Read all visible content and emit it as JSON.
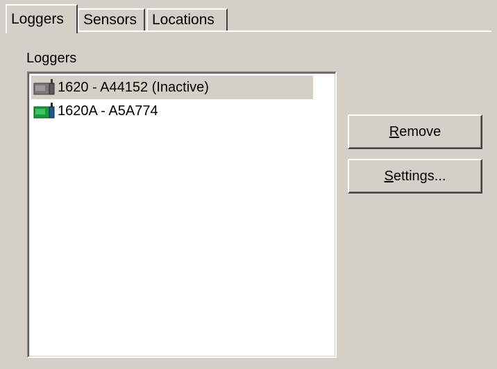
{
  "tabs": [
    {
      "label": "Loggers",
      "active": true
    },
    {
      "label": "Sensors",
      "active": false
    },
    {
      "label": "Locations",
      "active": false
    }
  ],
  "loggers_group": {
    "label": "Loggers"
  },
  "logger_list": [
    {
      "text": "1620 - A44152 (Inactive)",
      "icon": "logger-icon",
      "icon_state": "inactive",
      "selected": true
    },
    {
      "text": "1620A - A5A774",
      "icon": "logger-icon",
      "icon_state": "active",
      "selected": false
    }
  ],
  "buttons": {
    "remove": {
      "mnemonic": "R",
      "rest": "emove"
    },
    "settings": {
      "mnemonic": "S",
      "rest": "ettings..."
    }
  },
  "colors": {
    "window_bg": "#d4d0c8",
    "list_bg": "#ffffff",
    "icon_inactive": "#7a7a7a",
    "icon_active": "#1a9a3a"
  }
}
